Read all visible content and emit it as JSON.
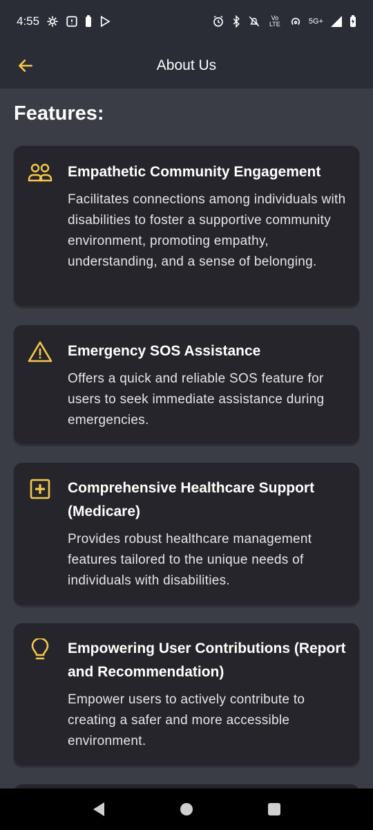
{
  "status_bar": {
    "time": "4:55",
    "network": "5G+",
    "volte": "Vo LTE"
  },
  "header": {
    "title": "About Us"
  },
  "section": {
    "title": "Features:"
  },
  "features": [
    {
      "icon": "people-icon",
      "title": "Empathetic Community Engagement",
      "description": "Facilitates connections among individuals with disabilities to foster a supportive community environment, promoting empathy, understanding, and a sense of belonging."
    },
    {
      "icon": "warning-icon",
      "title": "Emergency SOS Assistance",
      "description": "Offers a quick and reliable SOS feature for users to seek immediate assistance during emergencies."
    },
    {
      "icon": "medical-plus-icon",
      "title": "Comprehensive Healthcare Support (Medicare)",
      "description": "Provides robust healthcare management features tailored to the unique needs of individuals with disabilities."
    },
    {
      "icon": "lightbulb-icon",
      "title": "Empowering User Contributions (Report and Recommendation)",
      "description": "Empower users to actively contribute to creating a safer and more accessible environment."
    }
  ],
  "colors": {
    "accent": "#f5c84c",
    "background": "#3a3d46",
    "card": "#26252b",
    "bar": "#2a2d35"
  }
}
